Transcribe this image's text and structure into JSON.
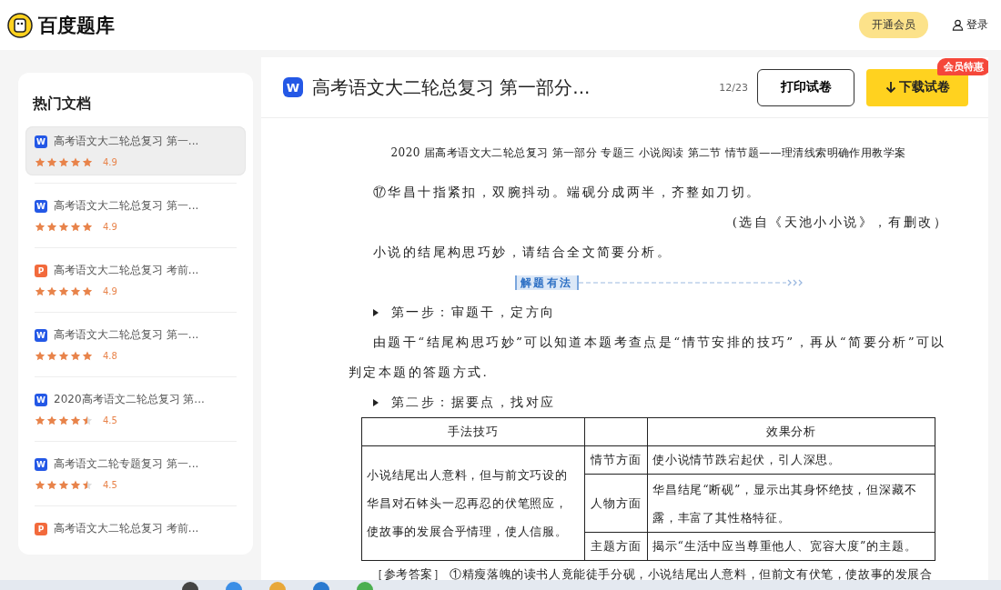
{
  "header": {
    "logo_text": "百度题库",
    "vip_button": "开通会员",
    "login_link": "登录"
  },
  "sidebar": {
    "title": "热门文档",
    "items": [
      {
        "color": "#2458e6",
        "badge": "W",
        "title": "高考语文大二轮总复习 第一...",
        "stars": 5,
        "rating": "4.9",
        "selected": true
      },
      {
        "color": "#2458e6",
        "badge": "W",
        "title": "高考语文大二轮总复习 第一...",
        "stars": 5,
        "rating": "4.9",
        "selected": false
      },
      {
        "color": "#f26a3c",
        "badge": "P",
        "title": "高考语文大二轮总复习 考前...",
        "stars": 5,
        "rating": "4.9",
        "selected": false
      },
      {
        "color": "#2458e6",
        "badge": "W",
        "title": "高考语文大二轮总复习 第一...",
        "stars": 5,
        "rating": "4.8",
        "selected": false
      },
      {
        "color": "#2458e6",
        "badge": "W",
        "title": "2020高考语文二轮总复习 第...",
        "stars": 4.5,
        "rating": "4.5",
        "selected": false
      },
      {
        "color": "#2458e6",
        "badge": "W",
        "title": "高考语文二轮专题复习 第一...",
        "stars": 4.5,
        "rating": "4.5",
        "selected": false
      },
      {
        "color": "#f26a3c",
        "badge": "P",
        "title": "高考语文大二轮总复习 考前...",
        "selected": false
      }
    ]
  },
  "document": {
    "file_badge": "W",
    "title": "高考语文大二轮总复习 第一部分...",
    "page_counter": "12/23",
    "print_button": "打印试卷",
    "download_button": "下载试卷",
    "promo_badge": "会员特惠",
    "blocks": [
      {
        "kind": "heading",
        "text": "2020 届高考语文大二轮总复习  第一部分  专题三  小说阅读  第二节  情节题——理清线索明确作用教学案"
      },
      {
        "kind": "paragraph",
        "text": "⑰华昌十指紧扣，双腕抖动。端砚分成两半，齐整如刀切。"
      },
      {
        "kind": "source",
        "text": "(选自《天池小小说》，有删改）"
      },
      {
        "kind": "paragraph",
        "text": "小说的结尾构思巧妙，请结合全文简要分析。"
      },
      {
        "kind": "tag",
        "text": "解题有法"
      },
      {
        "kind": "step",
        "text": "第一步：审题干，定方向"
      },
      {
        "kind": "paragraph",
        "text": "由题干“结尾构思巧妙”可以知道本题考查点是“情节安排的技巧”，再从“简要分析”可以判定本题的答题方式."
      },
      {
        "kind": "step",
        "text": "第二步：据要点，找对应"
      },
      {
        "kind": "table",
        "headers": [
          "手法技巧",
          "效果分析"
        ],
        "technique": "小说结尾出人意料，但与前文巧设的华昌对石钵头一忍再忍的伏笔照应，使故事的发展合乎情理，使人信服。",
        "rows": [
          {
            "aspect": "情节方面",
            "effect": "使小说情节跌宕起伏，引人深思。"
          },
          {
            "aspect": "人物方面",
            "effect": "华昌结尾“断砚”，显示出其身怀绝技，但深藏不露，丰富了其性格特征。"
          },
          {
            "aspect": "主题方面",
            "effect": "揭示“生活中应当尊重他人、宽容大度”的主题。"
          }
        ]
      },
      {
        "kind": "answer",
        "text": "［参考答案］  ①精瘦落魄的读书人竟能徒手分砚，小说结尾出人意料，但前文有伏笔，使故事的发展合"
      }
    ]
  }
}
